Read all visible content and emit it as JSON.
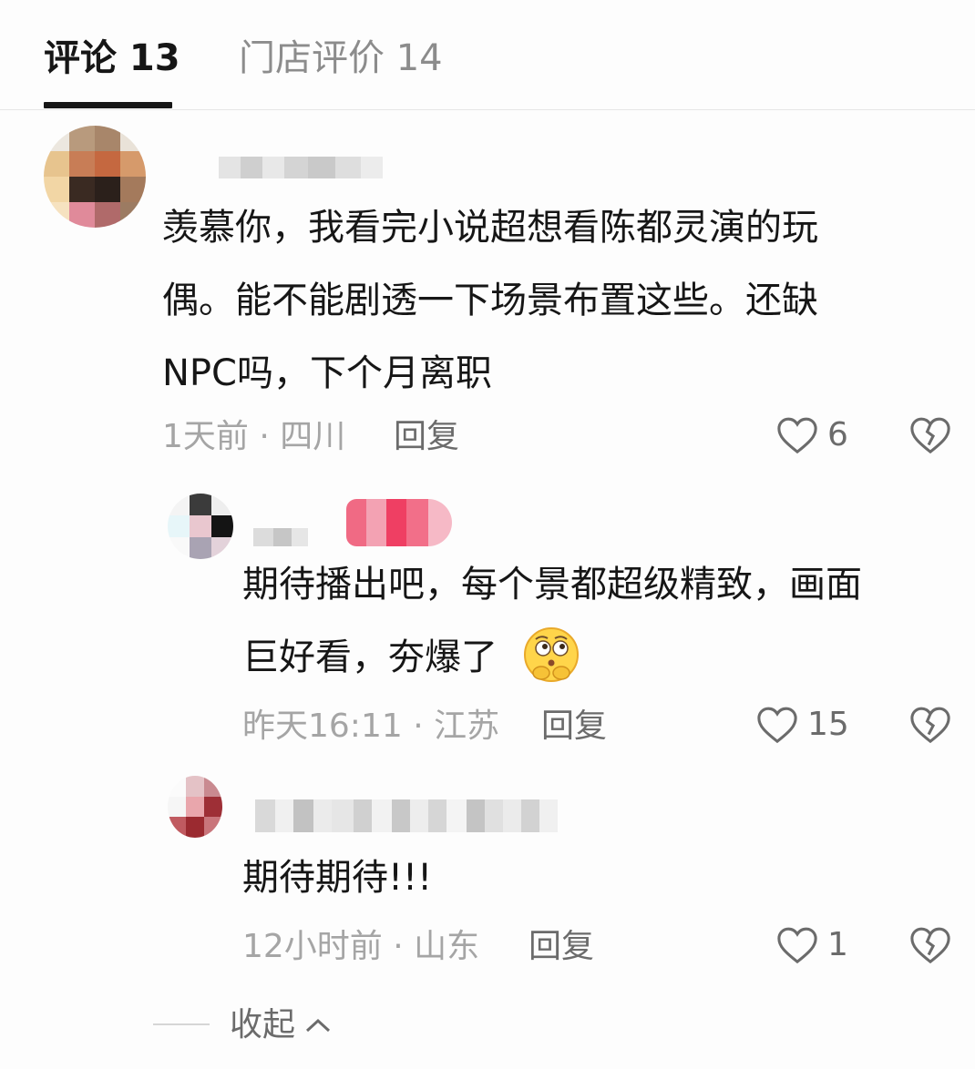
{
  "tabs": [
    {
      "label": "评论 13",
      "active": true
    },
    {
      "label": "门店评价 14",
      "active": false
    }
  ],
  "comments": [
    {
      "text_lines": [
        "羡慕你，我看完小说超想看陈都灵演的玩",
        "偶。能不能剧透一下场景布置这些。还缺",
        "NPC吗，下个月离职"
      ],
      "meta": "1天前 · 四川",
      "reply_label": "回复",
      "likes": "6"
    },
    {
      "text_lines": [
        "期待播出吧，每个景都超级精致，画面",
        "巨好看，夯爆了"
      ],
      "meta": "昨天16:11 · 江苏",
      "reply_label": "回复",
      "likes": "15",
      "emoji": "thinking-face-emoji"
    },
    {
      "text_lines": [
        "期待期待!!!"
      ],
      "meta": "12小时前 · 山东",
      "reply_label": "回复",
      "likes": "1"
    }
  ],
  "collapse_label": "收起",
  "icons": {
    "like": "heart-outline-icon",
    "dislike": "broken-heart-icon",
    "collapse": "chevron-up-icon"
  },
  "colors": {
    "active_tab": "#161616",
    "inactive_tab": "#8c8c8c",
    "meta": "#a5a5a5",
    "action": "#6b6b6b"
  }
}
